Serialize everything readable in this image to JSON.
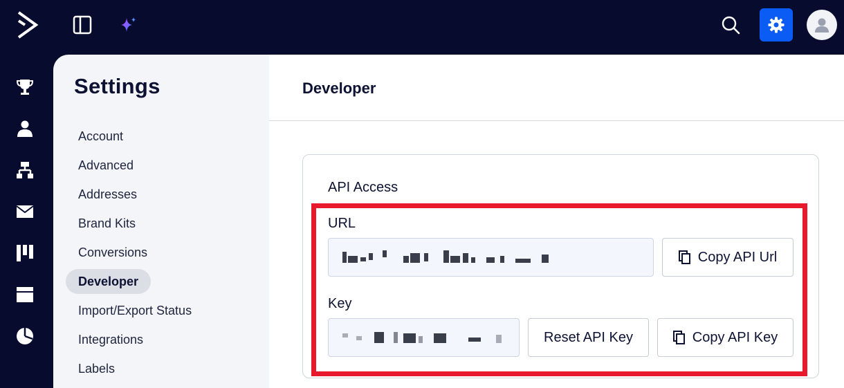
{
  "topbar": {
    "icons": [
      "logo-icon",
      "panel-toggle-icon",
      "sparkle-icon",
      "search-icon",
      "gear-icon",
      "user-avatar-icon"
    ]
  },
  "rail": {
    "icons": [
      "trophy-icon",
      "person-icon",
      "hierarchy-icon",
      "envelope-icon",
      "kanban-icon",
      "browser-window-icon",
      "pie-chart-icon"
    ]
  },
  "settings": {
    "title": "Settings",
    "nav": [
      {
        "label": "Account"
      },
      {
        "label": "Advanced"
      },
      {
        "label": "Addresses"
      },
      {
        "label": "Brand Kits"
      },
      {
        "label": "Conversions"
      },
      {
        "label": "Developer",
        "active": true
      },
      {
        "label": "Import/Export Status"
      },
      {
        "label": "Integrations"
      },
      {
        "label": "Labels"
      }
    ]
  },
  "main": {
    "title": "Developer",
    "card": {
      "title": "API Access",
      "url_label": "URL",
      "key_label": "Key",
      "copy_url_button": "Copy API Url",
      "reset_key_button": "Reset API Key",
      "copy_key_button": "Copy API Key"
    }
  },
  "colors": {
    "nav_bg": "#070b2e",
    "accent": "#0a5cf5",
    "highlight": "#e8192c"
  }
}
